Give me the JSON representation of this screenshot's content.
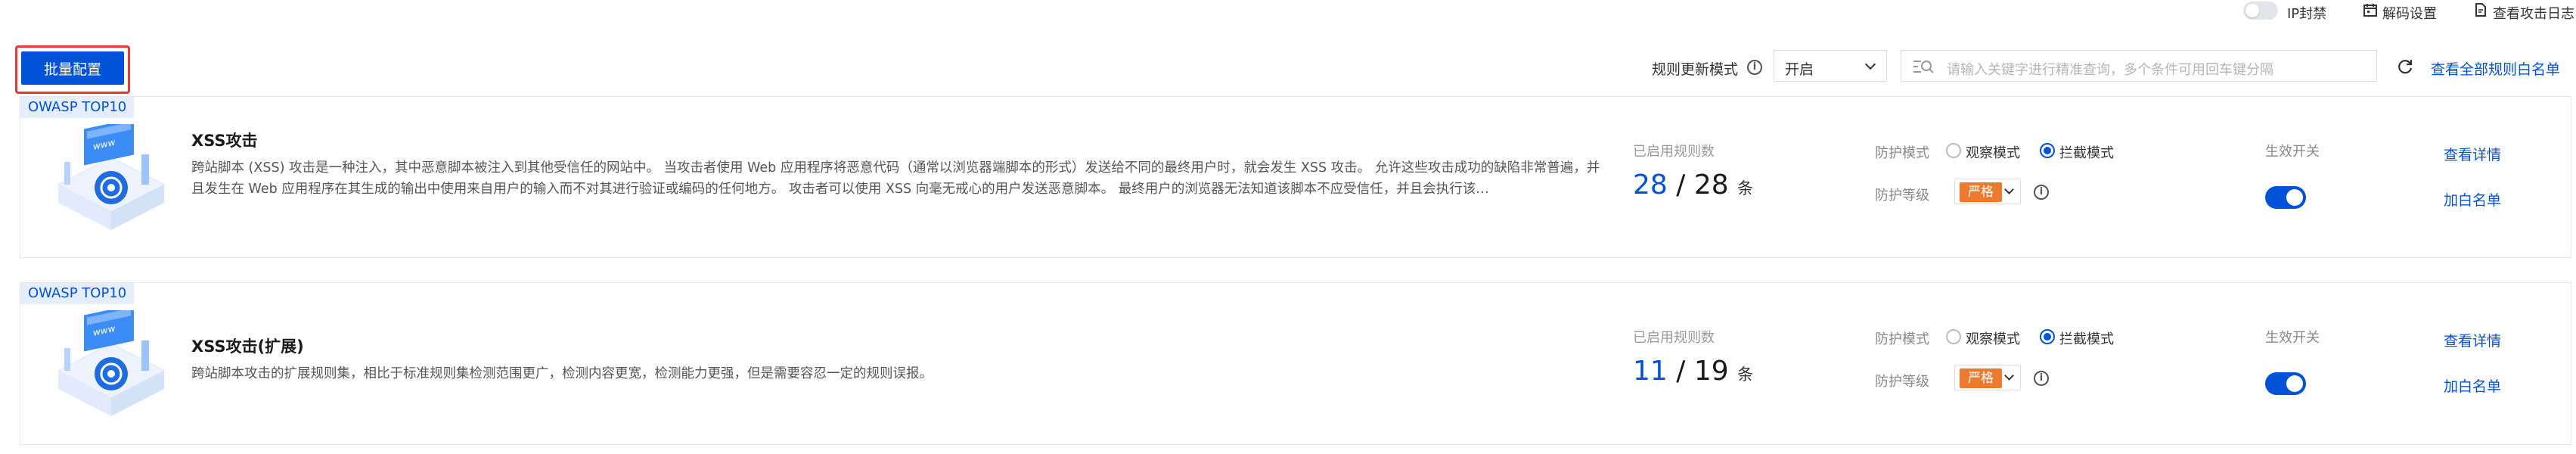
{
  "topbar": {
    "ip_ban_label": "IP封禁",
    "decode_settings_label": "解码设置",
    "attack_log_label": "查看攻击日志"
  },
  "toolbar": {
    "batch_config_label": "批量配置",
    "rule_update_mode_label": "规则更新模式",
    "rule_update_mode_value": "开启",
    "search_placeholder": "请输入关键字进行精准查询，多个条件可用回车键分隔",
    "view_all_whitelist_label": "查看全部规则白名单"
  },
  "colors": {
    "accent": "#0052d9",
    "danger_outline": "#e53935",
    "strict_badge": "#ed7b2f",
    "tag_bg": "#e5eeff"
  },
  "rules": [
    {
      "tag": "OWASP TOP10",
      "title": "XSS攻击",
      "description": "跨站脚本 (XSS) 攻击是一种注入，其中恶意脚本被注入到其他受信任的网站中。 当攻击者使用 Web 应用程序将恶意代码（通常以浏览器端脚本的形式）发送给不同的最终用户时，就会发生 XSS 攻击。 允许这些攻击成功的缺陷非常普遍，并且发生在 Web 应用程序在其生成的输出中使用来自用户的输入而不对其进行验证或编码的任何地方。 攻击者可以使用 XSS 向毫无戒心的用户发送恶意脚本。 最终用户的浏览器无法知道该脚本不应受信任，并且会执行该…",
      "enabled_label": "已启用规则数",
      "enabled_count": "28",
      "total_count": "28",
      "separator": "/",
      "unit": "条",
      "protect_mode_label": "防护模式",
      "observe_label": "观察模式",
      "block_label": "拦截模式",
      "protect_level_label": "防护等级",
      "level_value": "严格",
      "switch_label": "生效开关",
      "view_details_label": "查看详情",
      "add_whitelist_label": "加白名单"
    },
    {
      "tag": "OWASP TOP10",
      "title": "XSS攻击(扩展)",
      "description": "跨站脚本攻击的扩展规则集，相比于标准规则集检测范围更广，检测内容更宽，检测能力更强，但是需要容忍一定的规则误报。",
      "enabled_label": "已启用规则数",
      "enabled_count": "11",
      "total_count": "19",
      "separator": "/",
      "unit": "条",
      "protect_mode_label": "防护模式",
      "observe_label": "观察模式",
      "block_label": "拦截模式",
      "protect_level_label": "防护等级",
      "level_value": "严格",
      "switch_label": "生效开关",
      "view_details_label": "查看详情",
      "add_whitelist_label": "加白名单"
    }
  ]
}
